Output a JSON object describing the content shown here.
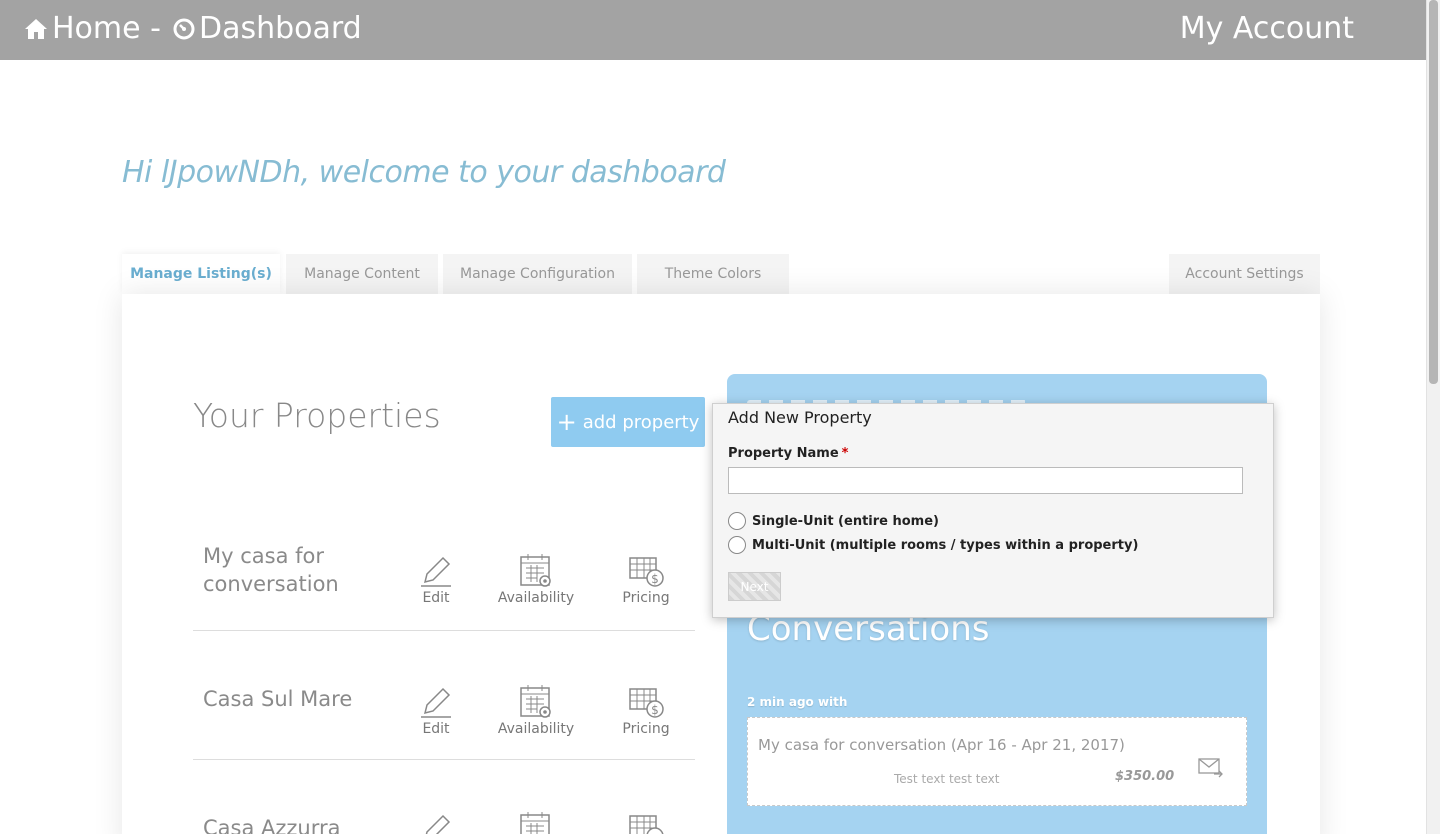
{
  "topbar": {
    "home_label": "Home -",
    "dashboard_label": "Dashboard",
    "account_label": "My Account"
  },
  "welcome": "Hi lJpowNDh, welcome to your dashboard",
  "tabs": {
    "listings": "Manage Listing(s)",
    "content": "Manage Content",
    "configuration": "Manage Configuration",
    "theme": "Theme Colors",
    "account": "Account Settings"
  },
  "properties": {
    "title": "Your Properties",
    "add_label": "add property",
    "actions": {
      "edit": "Edit",
      "availability": "Availability",
      "pricing": "Pricing"
    },
    "items": [
      {
        "name": "My casa for conversation"
      },
      {
        "name": "Casa Sul Mare"
      },
      {
        "name": "Casa Azzurra"
      }
    ]
  },
  "conversations": {
    "title": "Conversations",
    "meta": "2 min ago with",
    "item": {
      "property": "My casa for conversation (Apr 16 - Apr 21, 2017)",
      "message": "Test text test text",
      "price": "$350.00"
    }
  },
  "modal": {
    "title": "Add New Property",
    "field_label": "Property Name",
    "required_mark": "*",
    "name_value": "",
    "option_single": "Single-Unit (entire home)",
    "option_multi": "Multi-Unit (multiple rooms / types within a property)",
    "next_label": "Next"
  },
  "colors": {
    "topbar": "#a3a3a3",
    "accent": "#87bcd3",
    "button": "#8fcbf0",
    "card": "#a5d3f1"
  }
}
